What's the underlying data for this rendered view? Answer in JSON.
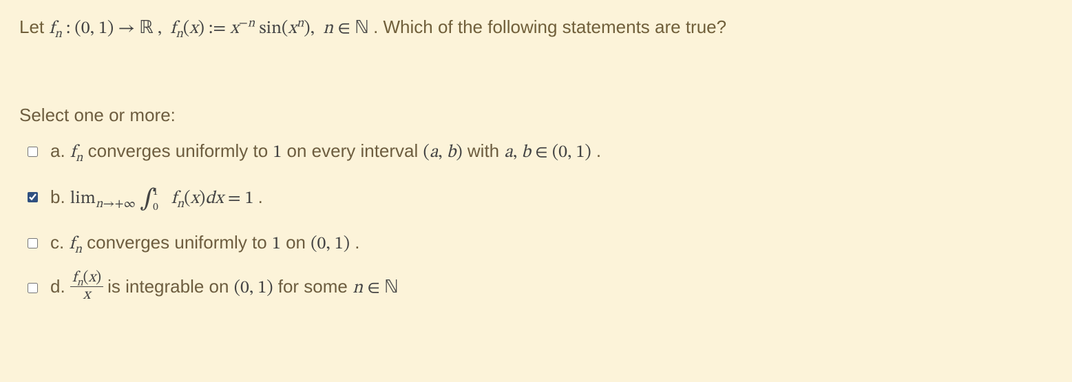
{
  "question": {
    "intro": "Let ",
    "mathPart": "f_n : (0, 1) → ℝ ,  f_n(x) := x^{−n} sin(x^n),  n ∈ ℕ",
    "outro": " . Which of the following statements are true?"
  },
  "prompt": "Select one or more:",
  "options": [
    {
      "letter": "a.",
      "checked": false,
      "pre": "f_n",
      "text1": " converges uniformly to ",
      "mid1": "1",
      "text2": " on every interval ",
      "mid2": "(a, b)",
      "text3": " with ",
      "mid3": "a, b ∈ (0, 1)",
      "text4": "."
    },
    {
      "letter": "b.",
      "checked": true,
      "pre": "lim_{n→+∞} ∫_0^1 f_n(x) dx = 1",
      "text1": ".",
      "mid1": "",
      "text2": "",
      "mid2": "",
      "text3": "",
      "mid3": "",
      "text4": ""
    },
    {
      "letter": "c.",
      "checked": false,
      "pre": "f_n",
      "text1": " converges uniformly to ",
      "mid1": "1",
      "text2": " on ",
      "mid2": "(0, 1)",
      "text3": ".",
      "mid3": "",
      "text4": ""
    },
    {
      "letter": "d.",
      "checked": false,
      "pre": "f_n(x)/x",
      "text1": " is integrable on ",
      "mid1": "(0, 1)",
      "text2": " for some ",
      "mid2": "n ∈ ℕ",
      "text3": "",
      "mid3": "",
      "text4": ""
    }
  ]
}
